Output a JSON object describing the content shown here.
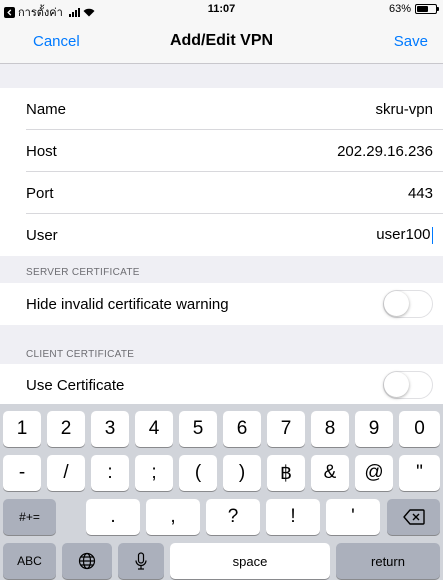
{
  "status_bar": {
    "back_app": "การตั้งค่า",
    "time": "11:07",
    "battery": "63%",
    "battery_level": 0.63
  },
  "nav": {
    "cancel": "Cancel",
    "title": "Add/Edit VPN",
    "save": "Save"
  },
  "vpn": {
    "name_label": "Name",
    "name_value": "skru-vpn",
    "host_label": "Host",
    "host_value": "202.29.16.236",
    "port_label": "Port",
    "port_value": "443",
    "user_label": "User",
    "user_value": "user100"
  },
  "server_certificate": {
    "header": "SERVER CERTIFICATE",
    "hide_invalid_label": "Hide invalid certificate warning",
    "hide_invalid_on": false
  },
  "client_certificate": {
    "header": "CLIENT CERTIFICATE",
    "use_certificate_label": "Use Certificate",
    "use_certificate_on": false
  },
  "keyboard": {
    "row1": [
      "1",
      "2",
      "3",
      "4",
      "5",
      "6",
      "7",
      "8",
      "9",
      "0"
    ],
    "row2": [
      "-",
      "/",
      ":",
      ";",
      "(",
      ")",
      "฿",
      "&",
      "@",
      "\""
    ],
    "row3": [
      ".",
      ",",
      "?",
      "!",
      "'"
    ],
    "symbols_key": "#+=",
    "abc_key": "ABC",
    "space_key": "space",
    "return_key": "return"
  },
  "icons": {
    "back_app": "back-arrow-icon",
    "signal": "signal-bars-icon",
    "wifi": "wifi-icon",
    "battery": "battery-icon",
    "globe": "globe-icon",
    "microphone": "microphone-icon",
    "delete": "delete-backspace-icon"
  },
  "colors": {
    "accent": "#007aff",
    "background": "#efeff4",
    "keyboard_bg": "#d1d4da",
    "key_dark": "#abb0bc"
  }
}
